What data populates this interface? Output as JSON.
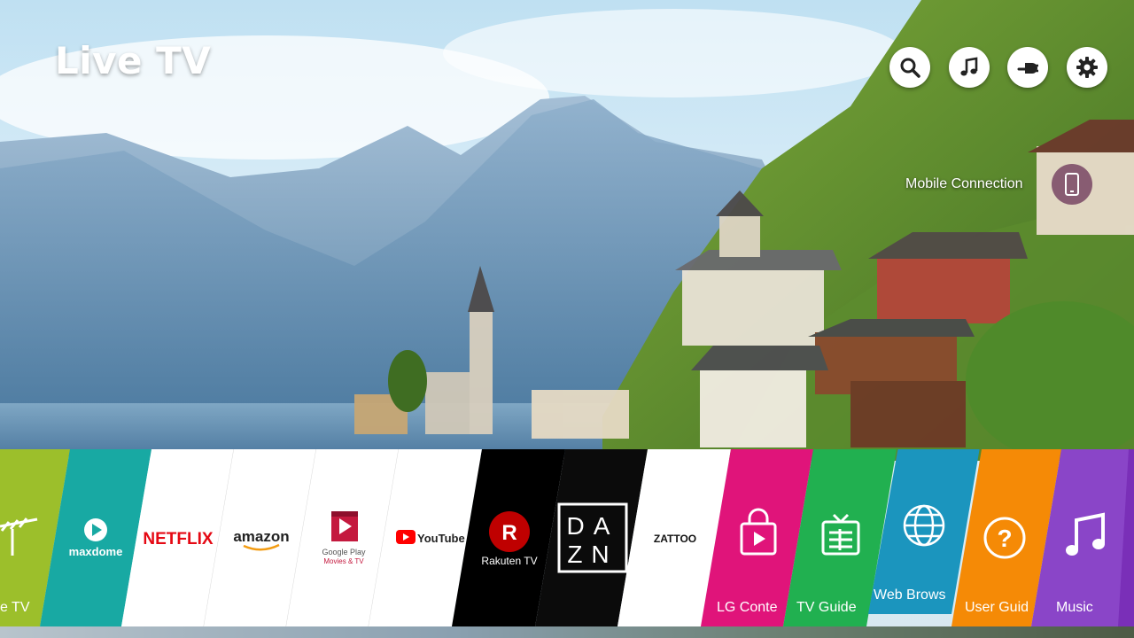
{
  "header": {
    "title": "Live TV"
  },
  "top_icons": [
    {
      "name": "search",
      "icon": "search-icon"
    },
    {
      "name": "music",
      "icon": "music-note-icon"
    },
    {
      "name": "input",
      "icon": "input-plug-icon"
    },
    {
      "name": "settings",
      "icon": "gear-icon"
    }
  ],
  "mobile_connection": {
    "label": "Mobile Connection",
    "icon": "phone-icon"
  },
  "launcher": {
    "tiles": [
      {
        "id": "live-tv",
        "label": "e TV",
        "color": "#9cbf2b"
      },
      {
        "id": "maxdome",
        "brand": "maxdome",
        "color": "#18a9a3"
      },
      {
        "id": "netflix",
        "brand": "NETFLIX",
        "color": "#ffffff"
      },
      {
        "id": "amazon",
        "brand": "amazon",
        "color": "#ffffff"
      },
      {
        "id": "google-play",
        "brand": "Google Play",
        "brand_sub": "Movies & TV",
        "color": "#ffffff"
      },
      {
        "id": "youtube",
        "brand": "YouTube",
        "color": "#ffffff"
      },
      {
        "id": "rakuten",
        "brand": "Rakuten TV",
        "color": "#000000"
      },
      {
        "id": "dazn",
        "brand": "DA ZN",
        "color": "#0b0b0b"
      },
      {
        "id": "zattoo",
        "brand": "ZATTOO",
        "color": "#ffffff"
      },
      {
        "id": "lg-content",
        "label": "LG Conte",
        "color": "#e0147a"
      },
      {
        "id": "tv-guide",
        "label": "TV Guide",
        "color": "#21b050"
      },
      {
        "id": "web-browser",
        "label": "Web Brows",
        "color": "#1b95be"
      },
      {
        "id": "user-guide",
        "label": "User Guid",
        "color": "#f58a06"
      },
      {
        "id": "music",
        "label": "Music",
        "color": "#8a45c8"
      }
    ]
  }
}
